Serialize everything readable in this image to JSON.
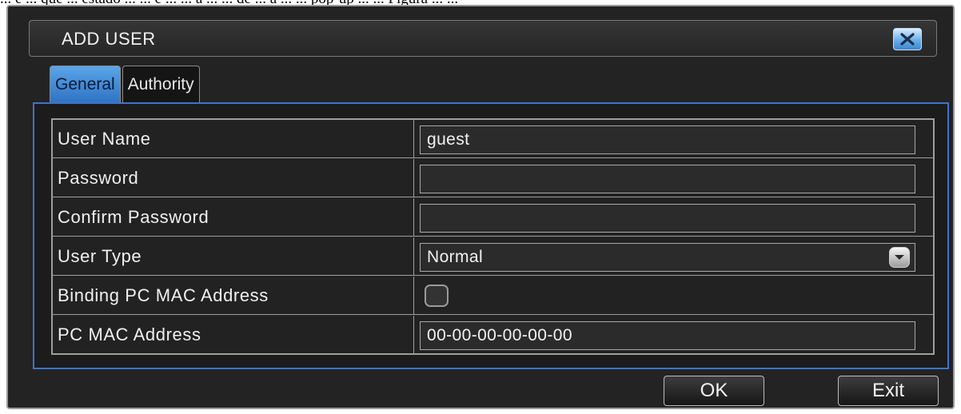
{
  "caption": "... e ... que ... estado ... ... e ... ... a ... ... de ... a ... ... pop-up ... ... Figura ... ...",
  "dialog": {
    "title": "ADD USER",
    "close_icon": "close-x-icon"
  },
  "tabs": [
    {
      "label": "General",
      "active": true
    },
    {
      "label": "Authority",
      "active": false
    }
  ],
  "form": {
    "user_name": {
      "label": "User Name",
      "value": "guest"
    },
    "password": {
      "label": "Password",
      "value": ""
    },
    "confirm_password": {
      "label": "Confirm Password",
      "value": ""
    },
    "user_type": {
      "label": "User Type",
      "value": "Normal",
      "icon": "chevron-down-icon"
    },
    "binding_mac": {
      "label": "Binding PC MAC Address",
      "checked": false
    },
    "pc_mac": {
      "label": "PC MAC Address",
      "value": "00-00-00-00-00-00"
    }
  },
  "buttons": {
    "ok": "OK",
    "exit": "Exit"
  },
  "colors": {
    "dialog_bg": "#232323",
    "accent_blue": "#3f73c9",
    "tab_active": "#2f74c3",
    "text": "#f0f0f0"
  }
}
